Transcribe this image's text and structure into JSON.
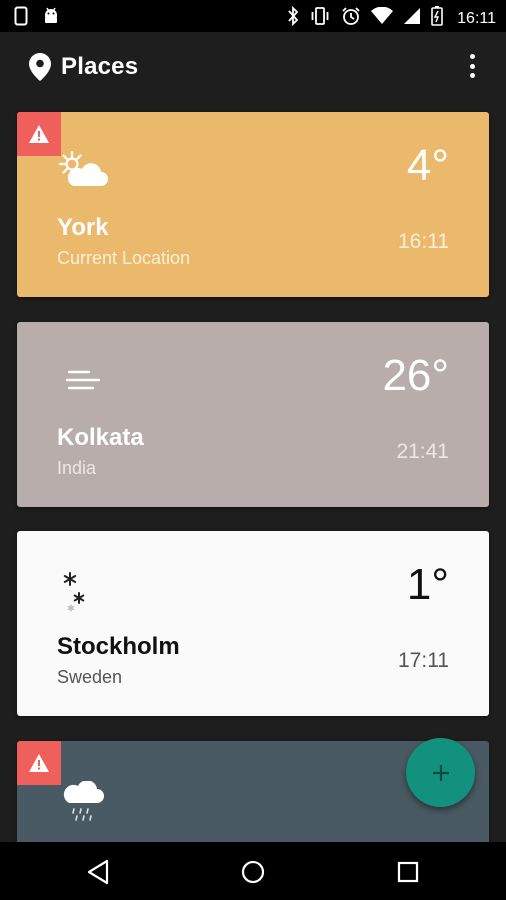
{
  "status_bar": {
    "time": "16:11",
    "left_icons": [
      "phone-outline-icon",
      "android-icon"
    ],
    "right_icons": [
      "bluetooth-icon",
      "vibrate-icon",
      "alarm-icon",
      "wifi-icon",
      "signal-icon",
      "battery-icon"
    ]
  },
  "app_bar": {
    "title": "Places",
    "icon": "location-pin-icon",
    "menu_icon": "more-vert-icon"
  },
  "cards": [
    {
      "city": "York",
      "subtitle": "Current Location",
      "temp": "4°",
      "time": "16:11",
      "weather_icon": "partly-cloudy-icon",
      "alert": true,
      "color": "#ebb96b"
    },
    {
      "city": "Kolkata",
      "subtitle": "India",
      "temp": "26°",
      "time": "21:41",
      "weather_icon": "fog-icon",
      "alert": false,
      "color": "#b8adab"
    },
    {
      "city": "Stockholm",
      "subtitle": "Sweden",
      "temp": "1°",
      "time": "17:11",
      "weather_icon": "snow-icon",
      "alert": false,
      "color": "#fafafa"
    },
    {
      "weather_icon": "rain-icon",
      "alert": true,
      "color": "#4a5a64"
    }
  ],
  "fab": {
    "icon": "add-icon",
    "color": "#11917e"
  },
  "nav_bar": {
    "icons": [
      "back-icon",
      "home-icon",
      "recents-icon"
    ]
  },
  "colors": {
    "alert": "#ef5f5c",
    "background": "#1e1e1e"
  }
}
